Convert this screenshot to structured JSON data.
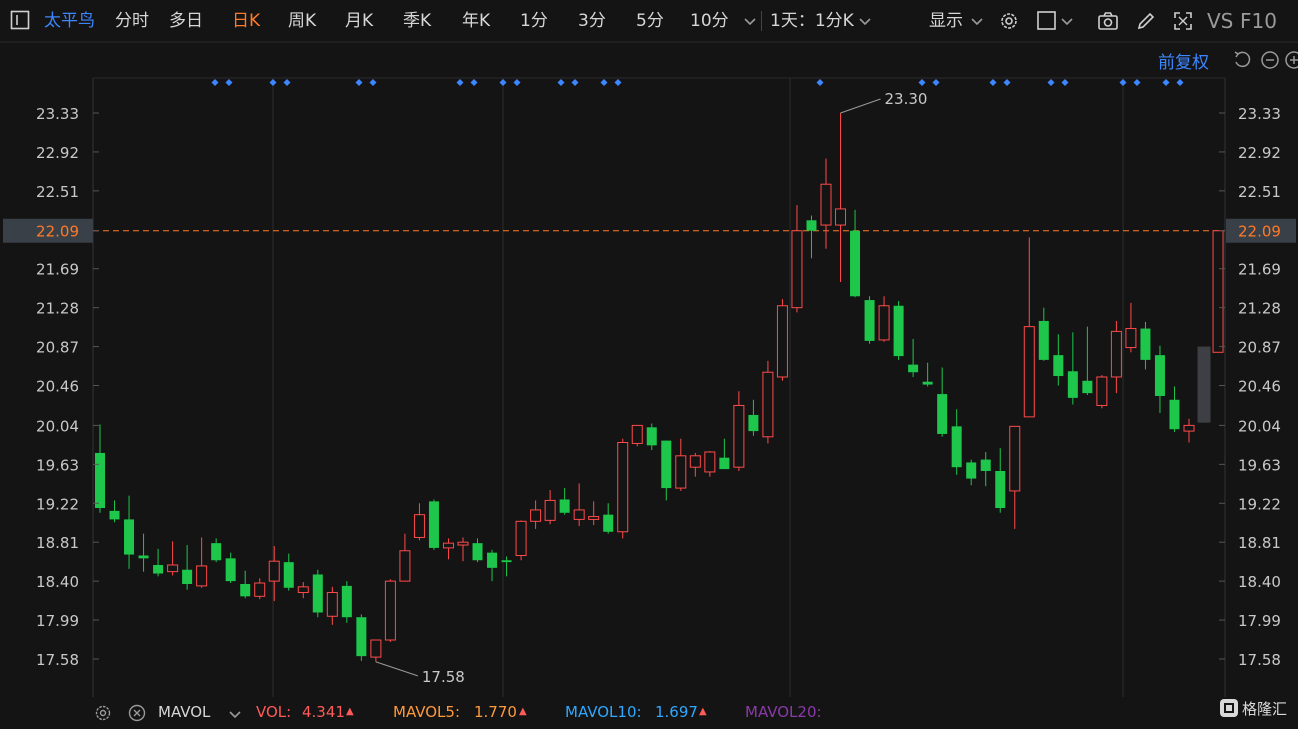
{
  "toolbar": {
    "stock_name": "太平鸟",
    "tabs": [
      {
        "label": "分时",
        "active": false
      },
      {
        "label": "多日",
        "active": false
      },
      {
        "label": "日K",
        "active": true
      },
      {
        "label": "周K",
        "active": false
      },
      {
        "label": "月K",
        "active": false
      },
      {
        "label": "季K",
        "active": false
      },
      {
        "label": "年K",
        "active": false
      },
      {
        "label": "1分",
        "active": false
      },
      {
        "label": "3分",
        "active": false
      },
      {
        "label": "5分",
        "active": false
      },
      {
        "label": "10分",
        "active": false
      }
    ],
    "period_selector": "1天：1分K",
    "display_label": "显示",
    "vs_label": "VS",
    "f10_label": "F10",
    "icons": [
      "chevron-down-icon",
      "gear-icon",
      "checkbox-icon",
      "camera-icon",
      "pencil-icon",
      "fullscreen-icon"
    ]
  },
  "adjust_label": "前复权",
  "colors": {
    "up": "#ff4a4a",
    "down": "#1ec74b",
    "accent": "#ff7a26",
    "blue": "#3c86ff"
  },
  "chart_data": {
    "type": "candlestick",
    "y_ticks": [
      "23.33",
      "22.92",
      "22.51",
      "22.09",
      "21.69",
      "21.28",
      "20.87",
      "20.46",
      "20.04",
      "19.63",
      "19.22",
      "18.81",
      "18.40",
      "17.99",
      "17.58"
    ],
    "ylim": [
      17.4,
      23.75
    ],
    "current_price": "22.09",
    "high_label": "23.30",
    "low_label": "17.58",
    "candles": [
      {
        "o": 19.75,
        "h": 20.05,
        "l": 19.12,
        "c": 19.17
      },
      {
        "o": 19.14,
        "h": 19.25,
        "l": 19.02,
        "c": 19.05
      },
      {
        "o": 19.05,
        "h": 19.3,
        "l": 18.53,
        "c": 18.68
      },
      {
        "o": 18.67,
        "h": 18.9,
        "l": 18.5,
        "c": 18.64
      },
      {
        "o": 18.57,
        "h": 18.74,
        "l": 18.45,
        "c": 18.48
      },
      {
        "o": 18.5,
        "h": 18.82,
        "l": 18.46,
        "c": 18.57
      },
      {
        "o": 18.52,
        "h": 18.78,
        "l": 18.31,
        "c": 18.37
      },
      {
        "o": 18.35,
        "h": 18.86,
        "l": 18.33,
        "c": 18.56
      },
      {
        "o": 18.8,
        "h": 18.85,
        "l": 18.6,
        "c": 18.62
      },
      {
        "o": 18.64,
        "h": 18.7,
        "l": 18.38,
        "c": 18.4
      },
      {
        "o": 18.37,
        "h": 18.51,
        "l": 18.22,
        "c": 18.24
      },
      {
        "o": 18.24,
        "h": 18.43,
        "l": 18.21,
        "c": 18.38
      },
      {
        "o": 18.4,
        "h": 18.77,
        "l": 18.19,
        "c": 18.61
      },
      {
        "o": 18.6,
        "h": 18.69,
        "l": 18.3,
        "c": 18.33
      },
      {
        "o": 18.28,
        "h": 18.39,
        "l": 18.22,
        "c": 18.34
      },
      {
        "o": 18.47,
        "h": 18.52,
        "l": 18.02,
        "c": 18.07
      },
      {
        "o": 18.03,
        "h": 18.34,
        "l": 17.94,
        "c": 18.28
      },
      {
        "o": 18.35,
        "h": 18.4,
        "l": 17.96,
        "c": 18.02
      },
      {
        "o": 18.02,
        "h": 18.05,
        "l": 17.56,
        "c": 17.61
      },
      {
        "o": 17.6,
        "h": 17.78,
        "l": 17.55,
        "c": 17.78
      },
      {
        "o": 17.78,
        "h": 18.42,
        "l": 17.76,
        "c": 18.4
      },
      {
        "o": 18.4,
        "h": 18.9,
        "l": 18.4,
        "c": 18.72
      },
      {
        "o": 18.86,
        "h": 19.22,
        "l": 18.83,
        "c": 19.1
      },
      {
        "o": 19.24,
        "h": 19.26,
        "l": 18.73,
        "c": 18.75
      },
      {
        "o": 18.75,
        "h": 18.85,
        "l": 18.63,
        "c": 18.8
      },
      {
        "o": 18.78,
        "h": 18.86,
        "l": 18.61,
        "c": 18.81
      },
      {
        "o": 18.8,
        "h": 18.85,
        "l": 18.6,
        "c": 18.62
      },
      {
        "o": 18.7,
        "h": 18.73,
        "l": 18.4,
        "c": 18.54
      },
      {
        "o": 18.62,
        "h": 18.66,
        "l": 18.45,
        "c": 18.6
      },
      {
        "o": 18.67,
        "h": 19.04,
        "l": 18.62,
        "c": 19.03
      },
      {
        "o": 19.03,
        "h": 19.25,
        "l": 18.95,
        "c": 19.15
      },
      {
        "o": 19.04,
        "h": 19.36,
        "l": 19.0,
        "c": 19.25
      },
      {
        "o": 19.26,
        "h": 19.38,
        "l": 19.1,
        "c": 19.12
      },
      {
        "o": 19.05,
        "h": 19.43,
        "l": 18.98,
        "c": 19.15
      },
      {
        "o": 19.05,
        "h": 19.24,
        "l": 18.99,
        "c": 19.08
      },
      {
        "o": 19.1,
        "h": 19.22,
        "l": 18.9,
        "c": 18.92
      },
      {
        "o": 18.92,
        "h": 19.9,
        "l": 18.85,
        "c": 19.86
      },
      {
        "o": 19.85,
        "h": 20.03,
        "l": 19.82,
        "c": 20.04
      },
      {
        "o": 20.02,
        "h": 20.06,
        "l": 19.78,
        "c": 19.83
      },
      {
        "o": 19.88,
        "h": 19.88,
        "l": 19.25,
        "c": 19.38
      },
      {
        "o": 19.38,
        "h": 19.9,
        "l": 19.35,
        "c": 19.72
      },
      {
        "o": 19.6,
        "h": 19.75,
        "l": 19.5,
        "c": 19.72
      },
      {
        "o": 19.55,
        "h": 19.77,
        "l": 19.5,
        "c": 19.76
      },
      {
        "o": 19.7,
        "h": 19.9,
        "l": 19.58,
        "c": 19.58
      },
      {
        "o": 19.6,
        "h": 20.4,
        "l": 19.56,
        "c": 20.25
      },
      {
        "o": 20.15,
        "h": 20.31,
        "l": 19.93,
        "c": 19.98
      },
      {
        "o": 19.92,
        "h": 20.72,
        "l": 19.85,
        "c": 20.6
      },
      {
        "o": 20.55,
        "h": 21.37,
        "l": 20.51,
        "c": 21.3
      },
      {
        "o": 21.28,
        "h": 22.36,
        "l": 21.23,
        "c": 22.09
      },
      {
        "o": 22.2,
        "h": 22.25,
        "l": 21.8,
        "c": 22.09
      },
      {
        "o": 22.15,
        "h": 22.85,
        "l": 21.9,
        "c": 22.58
      },
      {
        "o": 22.15,
        "h": 23.33,
        "l": 21.55,
        "c": 22.32
      },
      {
        "o": 22.09,
        "h": 22.31,
        "l": 21.39,
        "c": 21.4
      },
      {
        "o": 21.36,
        "h": 21.4,
        "l": 20.9,
        "c": 20.93
      },
      {
        "o": 20.94,
        "h": 21.4,
        "l": 20.92,
        "c": 21.3
      },
      {
        "o": 21.3,
        "h": 21.35,
        "l": 20.73,
        "c": 20.77
      },
      {
        "o": 20.68,
        "h": 20.95,
        "l": 20.55,
        "c": 20.6
      },
      {
        "o": 20.5,
        "h": 20.7,
        "l": 20.45,
        "c": 20.47
      },
      {
        "o": 20.37,
        "h": 20.65,
        "l": 19.92,
        "c": 19.95
      },
      {
        "o": 20.03,
        "h": 20.21,
        "l": 19.52,
        "c": 19.6
      },
      {
        "o": 19.65,
        "h": 19.68,
        "l": 19.41,
        "c": 19.48
      },
      {
        "o": 19.68,
        "h": 19.76,
        "l": 19.4,
        "c": 19.56
      },
      {
        "o": 19.56,
        "h": 19.8,
        "l": 19.12,
        "c": 19.17
      },
      {
        "o": 19.35,
        "h": 20.0,
        "l": 18.95,
        "c": 20.03
      },
      {
        "o": 20.13,
        "h": 22.02,
        "l": 20.13,
        "c": 21.08
      },
      {
        "o": 21.14,
        "h": 21.28,
        "l": 20.72,
        "c": 20.73
      },
      {
        "o": 20.78,
        "h": 21.0,
        "l": 20.46,
        "c": 20.56
      },
      {
        "o": 20.61,
        "h": 21.02,
        "l": 20.26,
        "c": 20.33
      },
      {
        "o": 20.51,
        "h": 21.08,
        "l": 20.36,
        "c": 20.38
      },
      {
        "o": 20.25,
        "h": 20.57,
        "l": 20.22,
        "c": 20.55
      },
      {
        "o": 20.55,
        "h": 21.14,
        "l": 20.38,
        "c": 21.03
      },
      {
        "o": 20.86,
        "h": 21.33,
        "l": 20.81,
        "c": 21.06
      },
      {
        "o": 21.06,
        "h": 21.13,
        "l": 20.63,
        "c": 20.73
      },
      {
        "o": 20.78,
        "h": 20.88,
        "l": 20.17,
        "c": 20.35
      },
      {
        "o": 20.31,
        "h": 20.45,
        "l": 19.97,
        "c": 20.0
      },
      {
        "o": 19.98,
        "h": 20.11,
        "l": 19.86,
        "c": 20.04
      },
      {
        "o": 20.81,
        "h": 20.81,
        "l": 20.07,
        "c": 20.07
      },
      {
        "o": 20.81,
        "h": 22.09,
        "l": 20.81,
        "c": 22.09
      }
    ],
    "highlight_last": true
  },
  "status_bar": {
    "icons": [
      "gear-icon",
      "close-circle-icon",
      "chevron-down-icon"
    ],
    "indicator": "MAVOL",
    "vol_label": "VOL:",
    "vol_value": "4.341",
    "mavol5_label": "MAVOL5:",
    "mavol5_value": "1.770",
    "mavol10_label": "MAVOL10:",
    "mavol10_value": "1.697",
    "mavol20_label": "MAVOL20:",
    "brand": "格隆汇"
  }
}
